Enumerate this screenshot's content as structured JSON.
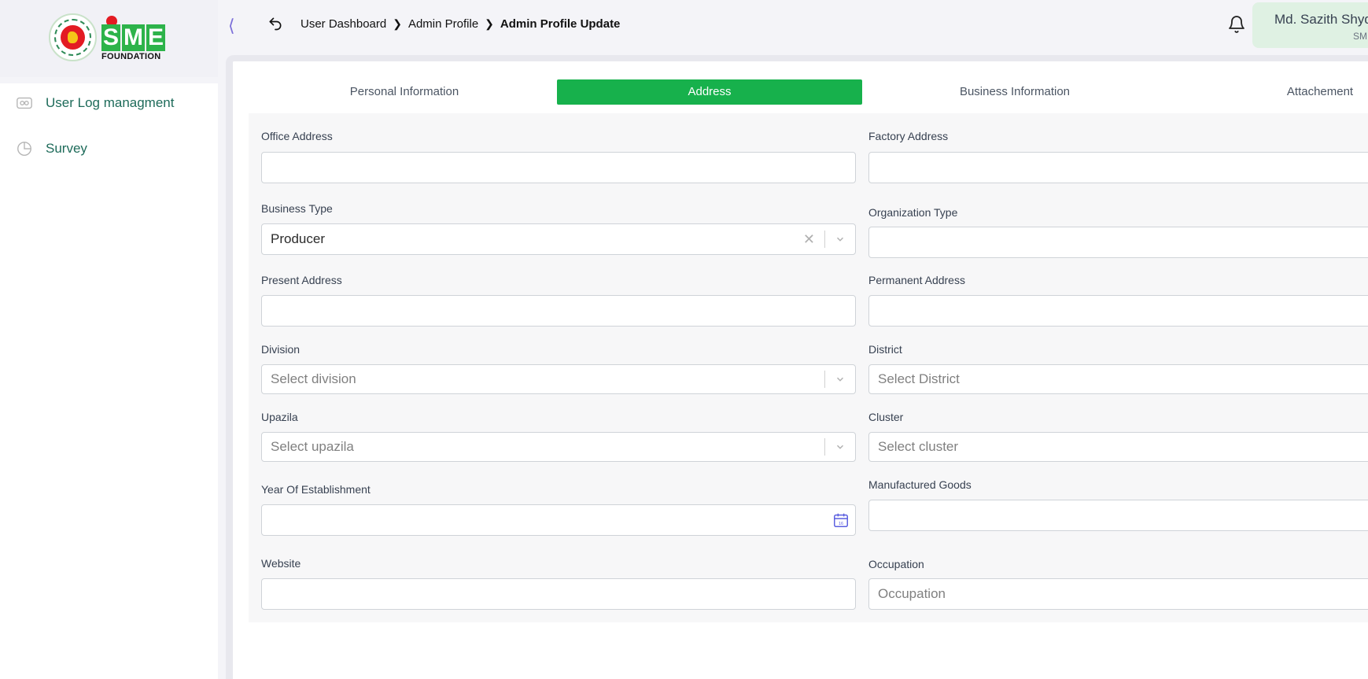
{
  "app": {
    "brand_letters": [
      "S",
      "M",
      "E"
    ],
    "brand_sub": "FOUNDATION"
  },
  "sidebar": {
    "items": [
      {
        "label": "User Log managment",
        "icon": "log-icon"
      },
      {
        "label": "Survey",
        "icon": "pie-chart-icon"
      }
    ]
  },
  "header": {
    "breadcrumbs": [
      "User Dashboard",
      "Admin Profile",
      "Admin Profile Update"
    ],
    "user_name": "Md. Sazith Shyd",
    "user_sub": "SM"
  },
  "tabs": [
    {
      "label": "Personal Information",
      "active": false
    },
    {
      "label": "Address",
      "active": true
    },
    {
      "label": "Business Information",
      "active": false
    },
    {
      "label": "Attachement",
      "active": false
    }
  ],
  "form": {
    "office_address": {
      "label": "Office Address",
      "value": ""
    },
    "factory_address": {
      "label": "Factory Address",
      "value": ""
    },
    "business_type": {
      "label": "Business Type",
      "value": "Producer"
    },
    "organization_type": {
      "label": "Organization Type",
      "value": ""
    },
    "present_address": {
      "label": "Present Address",
      "value": ""
    },
    "permanent_address": {
      "label": "Permanent Address",
      "value": ""
    },
    "division": {
      "label": "Division",
      "placeholder": "Select division"
    },
    "district": {
      "label": "District",
      "placeholder": "Select District"
    },
    "upazila": {
      "label": "Upazila",
      "placeholder": "Select upazila"
    },
    "cluster": {
      "label": "Cluster",
      "placeholder": "Select cluster"
    },
    "year_of_establishment": {
      "label": "Year Of Establishment",
      "value": ""
    },
    "manufactured_goods": {
      "label": "Manufactured Goods",
      "value": ""
    },
    "website": {
      "label": "Website",
      "value": ""
    },
    "occupation": {
      "label": "Occupation",
      "placeholder": "Occupation"
    }
  },
  "colors": {
    "accent_green": "#17b14c",
    "sidebar_text": "#1e6b5a",
    "user_card_bg": "#dff1e3"
  }
}
